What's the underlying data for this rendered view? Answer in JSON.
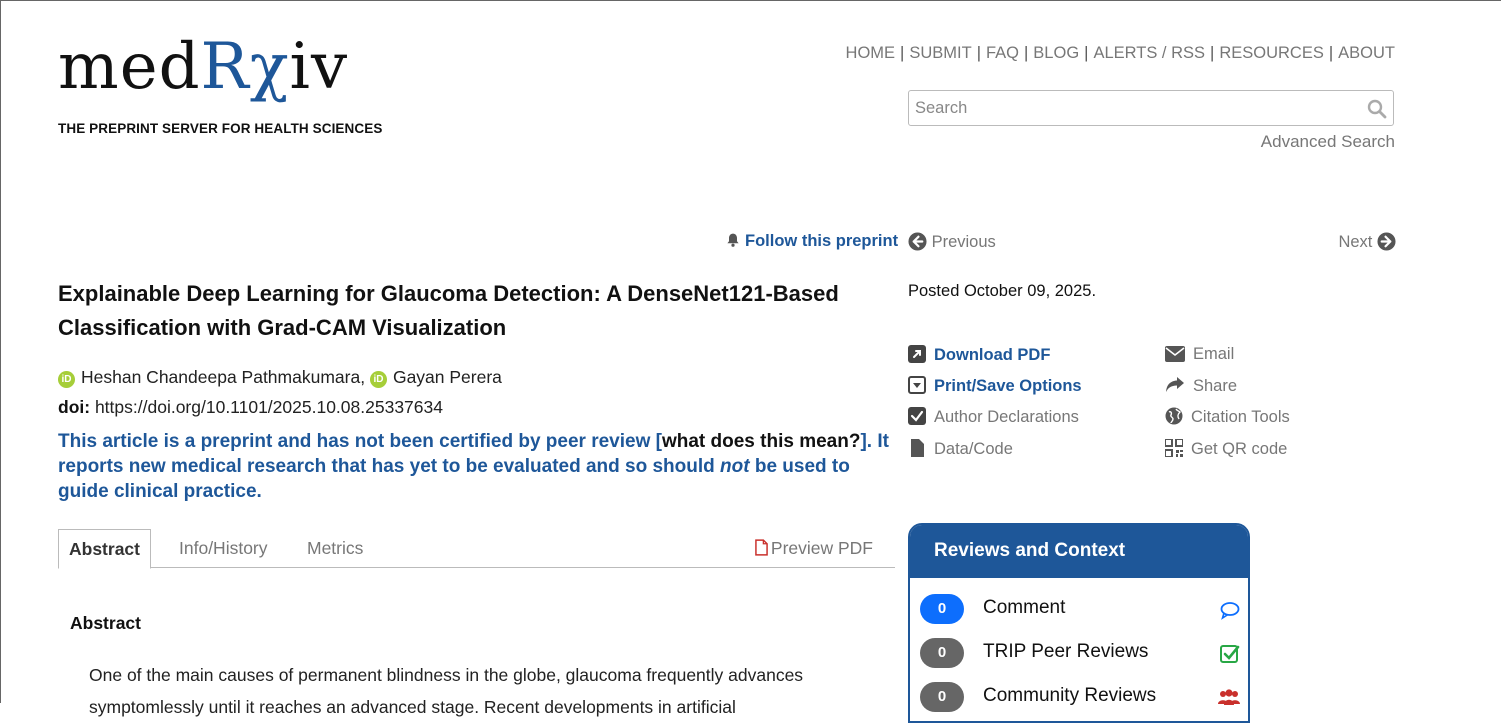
{
  "logo": {
    "part1": "med",
    "part2": "Rχ",
    "part3": "iv",
    "tagline": "THE PREPRINT SERVER FOR HEALTH SCIENCES"
  },
  "nav": {
    "items": [
      "HOME",
      "SUBMIT",
      "FAQ",
      "BLOG",
      "ALERTS / RSS",
      "RESOURCES",
      "ABOUT"
    ]
  },
  "search": {
    "placeholder": "Search",
    "advanced": "Advanced Search"
  },
  "follow": "Follow this preprint",
  "prev": "Previous",
  "next": "Next",
  "article": {
    "title": "Explainable Deep Learning for Glaucoma Detection: A DenseNet121-Based Classification with Grad-CAM Visualization",
    "authors": [
      "Heshan Chandeepa Pathmakumara",
      "Gayan Perera"
    ],
    "author_sep": ", ",
    "doi_label": "doi:",
    "doi": "https://doi.org/10.1101/2025.10.08.25337634",
    "notice_a": "This article is a preprint and has not been certified by peer review [",
    "notice_link": "what does this mean?",
    "notice_b": "]. It reports new medical research that has yet to be evaluated and so should ",
    "notice_em": "not",
    "notice_c": " be used to guide clinical practice."
  },
  "tabs": {
    "abstract": "Abstract",
    "info": "Info/History",
    "metrics": "Metrics",
    "preview": "Preview PDF"
  },
  "abstract": {
    "heading": "Abstract",
    "text": "One of the main causes of permanent blindness in the globe, glaucoma frequently advances symptomlessly until it reaches an advanced stage. Recent developments in artificial"
  },
  "sidebar": {
    "posted": "Posted October 09, 2025.",
    "actions": {
      "download": "Download PDF",
      "print": "Print/Save Options",
      "declarations": "Author Declarations",
      "data": "Data/Code",
      "email": "Email",
      "share": "Share",
      "citation": "Citation Tools",
      "qr": "Get QR code"
    }
  },
  "reviews": {
    "title": "Reviews and Context",
    "rows": [
      {
        "count": "0",
        "label": "Comment",
        "color": "#0d6efd"
      },
      {
        "count": "0",
        "label": "TRIP Peer Reviews",
        "color": "#666666"
      },
      {
        "count": "0",
        "label": "Community Reviews",
        "color": "#666666"
      }
    ]
  },
  "colors": {
    "brand": "#1e5799",
    "orcid": "#a6ce39",
    "pdf_red": "#c9302c",
    "check_green": "#28a745",
    "users_red": "#c9302c"
  }
}
